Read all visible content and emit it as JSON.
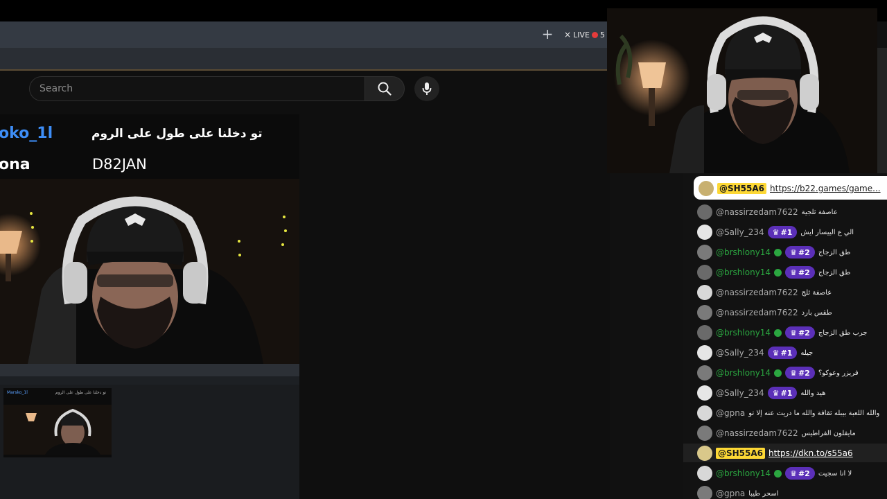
{
  "browser": {
    "new_tab_symbol": "+",
    "live_tab": {
      "close": "×",
      "label": "LIVE",
      "count": "5"
    }
  },
  "youtube": {
    "search_placeholder": "Search"
  },
  "video_overlay": {
    "rows": [
      {
        "name": "oko_1l",
        "message": "تو دخلنا على طول على الروم"
      },
      {
        "name": "ona",
        "message": "D82JAN"
      }
    ]
  },
  "mini_preview": {
    "name": "Marsko_1l",
    "message": "تو دخلنا على طول على الروم"
  },
  "chat": {
    "pinned": {
      "user": "@SH55A6",
      "link": "https://b22.games/game..."
    },
    "messages": [
      {
        "user": "@nassirzedam7622",
        "badge": "",
        "mod": false,
        "text": "عاصفة ثلجية"
      },
      {
        "user": "@Sally_234",
        "badge": "#1",
        "mod": false,
        "text": "الي ع الييسار ايش"
      },
      {
        "user": "@brshlony14",
        "badge": "#2",
        "mod": true,
        "text": "طق الزجاج"
      },
      {
        "user": "@brshlony14",
        "badge": "#2",
        "mod": true,
        "text": "طق الزجاج"
      },
      {
        "user": "@nassirzedam7622",
        "badge": "",
        "mod": false,
        "text": "عاصفة ثلج"
      },
      {
        "user": "@nassirzedam7622",
        "badge": "",
        "mod": false,
        "text": "طقس بارد"
      },
      {
        "user": "@brshlony14",
        "badge": "#2",
        "mod": true,
        "text": "جرب طق الزجاج"
      },
      {
        "user": "@Sally_234",
        "badge": "#1",
        "mod": false,
        "text": "جيله"
      },
      {
        "user": "@brshlony14",
        "badge": "#2",
        "mod": true,
        "text": "فريزر وعوكو؟"
      },
      {
        "user": "@Sally_234",
        "badge": "#1",
        "mod": false,
        "text": "هيد والله"
      },
      {
        "user": "@gpna",
        "badge": "",
        "mod": false,
        "text": "والله اللعبة بيبله ثقافة والله ما دريت عنه إلا تو"
      },
      {
        "user": "@nassirzedam7622",
        "badge": "",
        "mod": false,
        "text": "مايفلون الفراطيس"
      },
      {
        "user": "@SH55A6",
        "badge": "",
        "mod": false,
        "link": "https://dkn.to/s55a6",
        "highlight": true
      },
      {
        "user": "@brshlony14",
        "badge": "#2",
        "mod": true,
        "text": "لا انا سجيت"
      },
      {
        "user": "@gpna",
        "badge": "",
        "mod": false,
        "text": "اسحر طيبا"
      }
    ]
  },
  "colors": {
    "accent_badge": "#5b2fb8",
    "moderator_green": "#2ba640",
    "sponsor_yellow": "#fdd835"
  }
}
